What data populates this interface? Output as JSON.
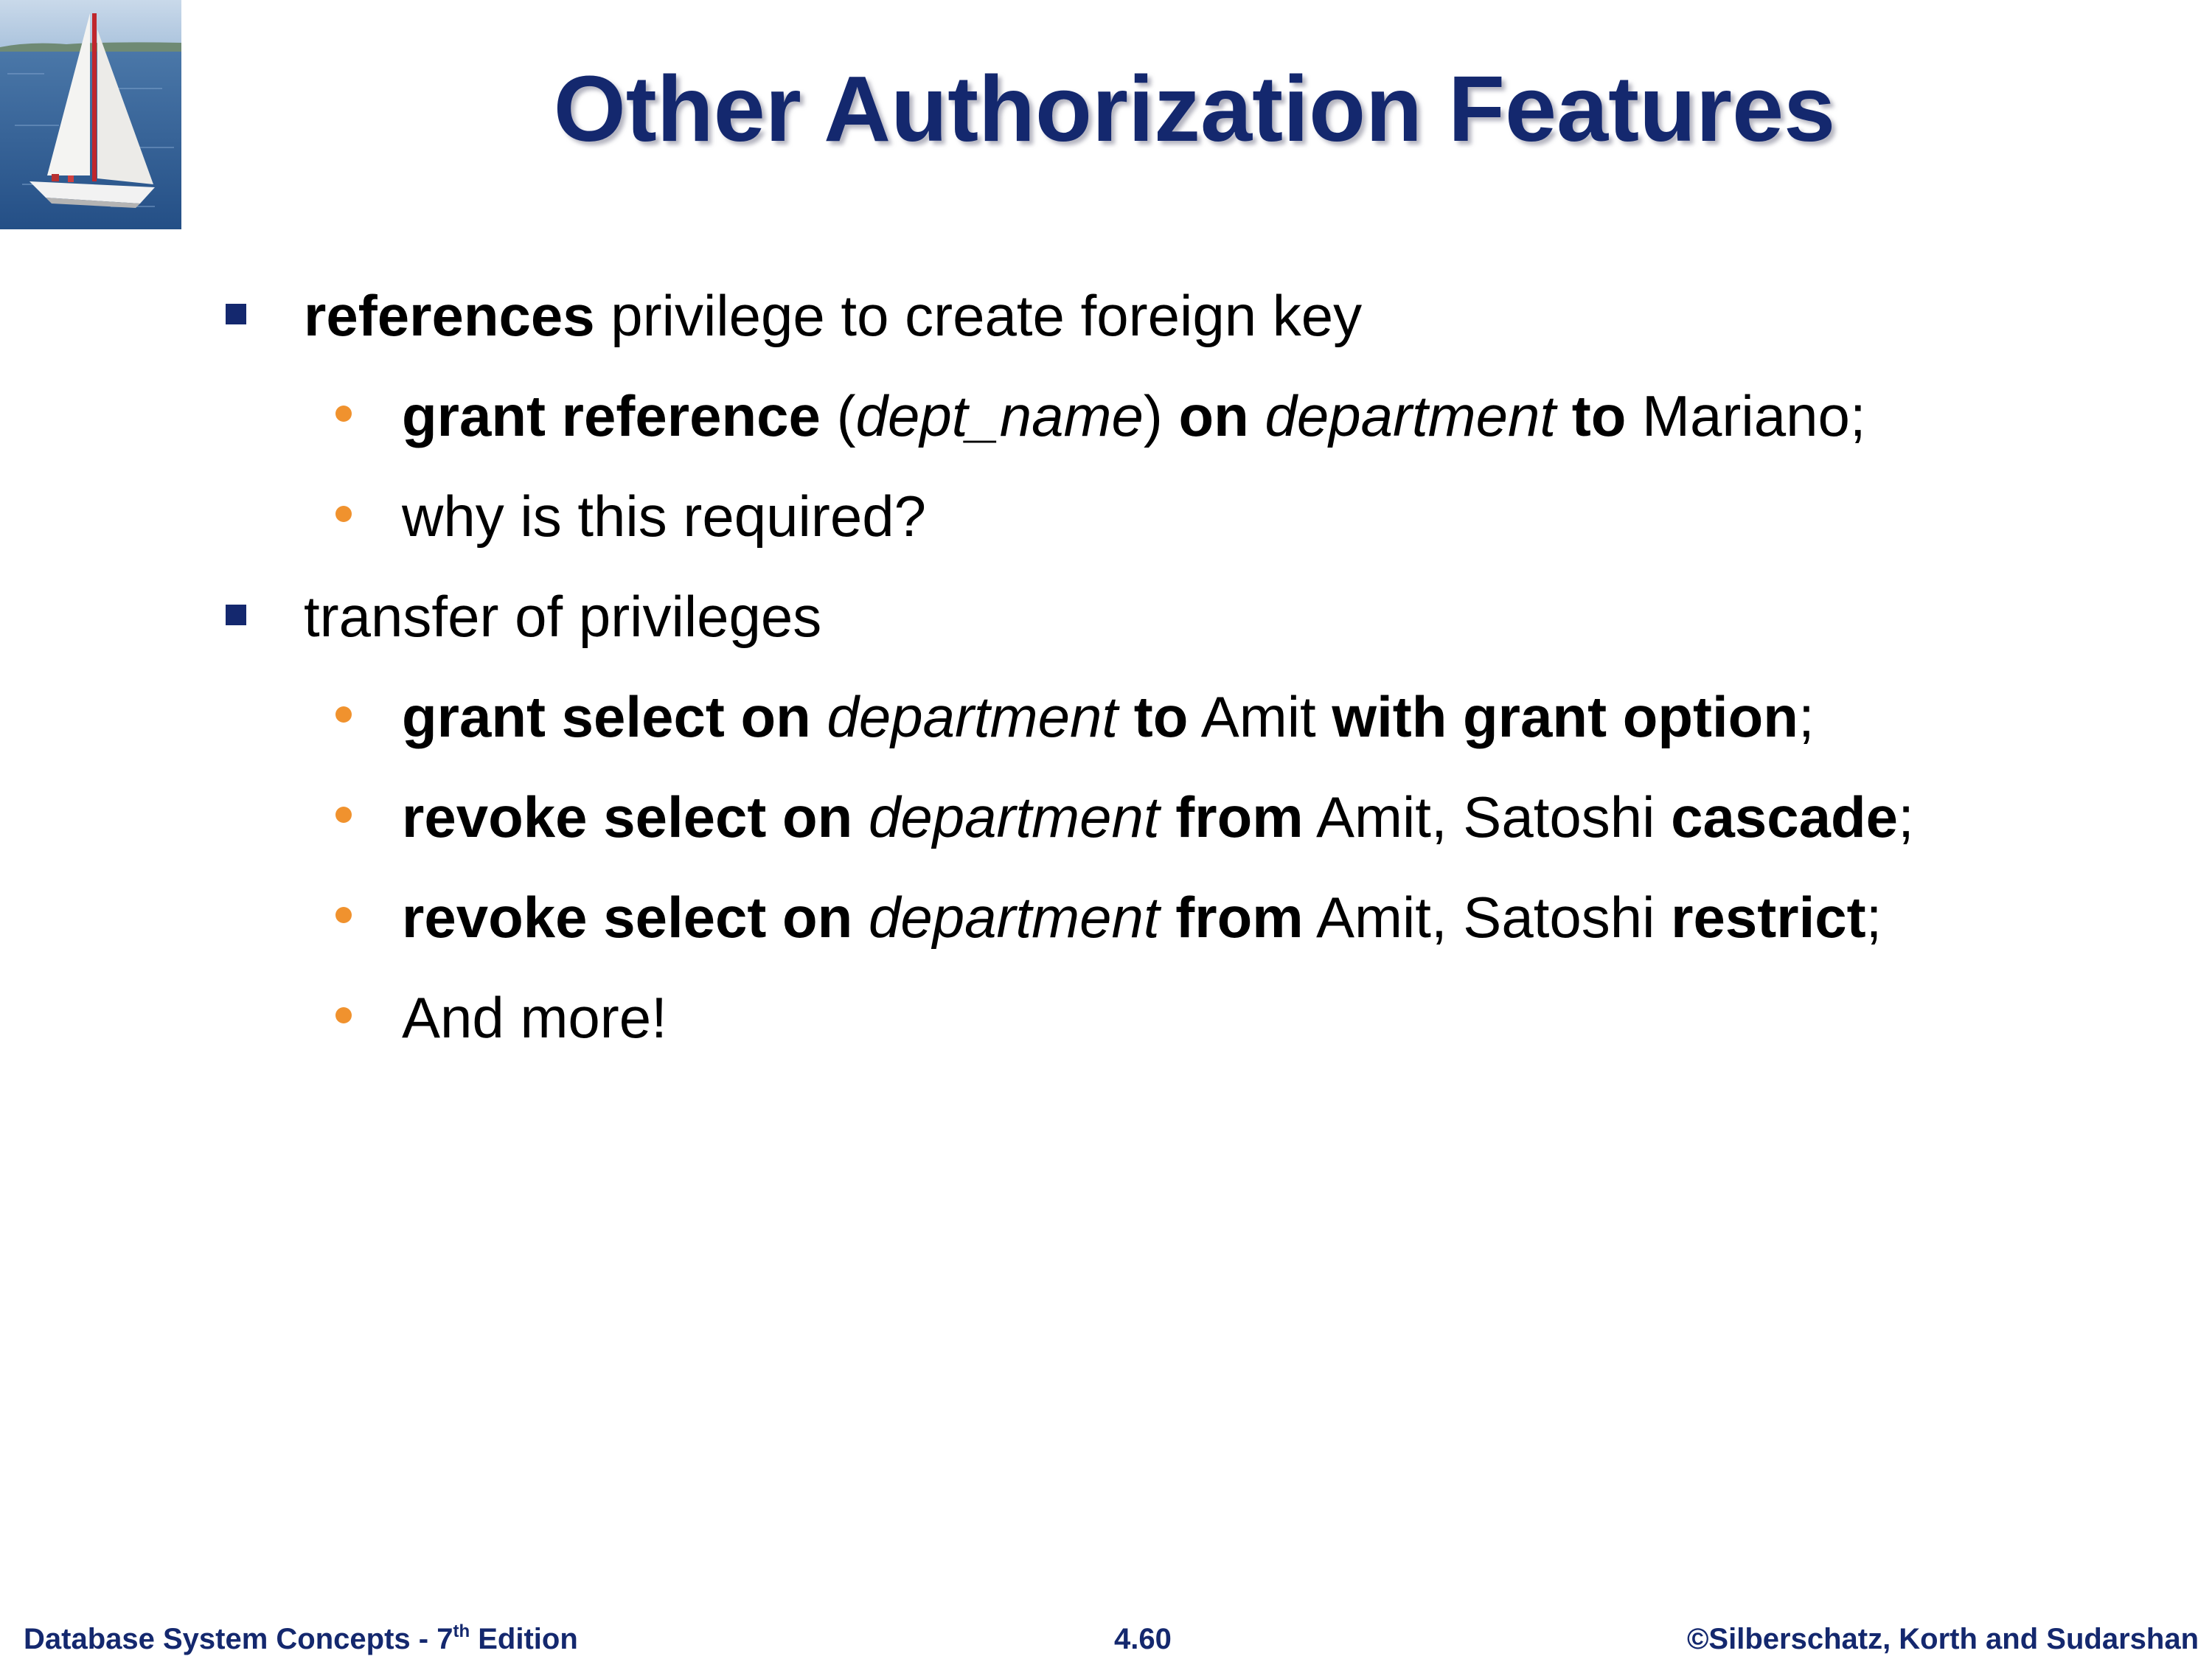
{
  "slide": {
    "title": "Other Authorization Features",
    "logo_icon": "sailboat-photo",
    "colors": {
      "title": "#14286e",
      "square_bullet": "#14286e",
      "dot_bullet": "#f0922e",
      "footer": "#14286e"
    }
  },
  "bullets": {
    "b1": {
      "bold": "references",
      "rest": " privilege to create foreign key"
    },
    "b1_1": {
      "p1": "grant reference",
      "p2": " (",
      "p3": "dept_name",
      "p4": ") ",
      "p5": "on",
      "p6": " ",
      "p7": "department",
      "p8": " ",
      "p9": "to",
      "p10": " Mariano;"
    },
    "b1_2": {
      "text": "why is this required?"
    },
    "b2": {
      "text": "transfer of privileges"
    },
    "b2_1": {
      "p1": "grant select on",
      "p2": " ",
      "p3": "department",
      "p4": " ",
      "p5": "to",
      "p6": " Amit ",
      "p7": "with grant option",
      "p8": ";"
    },
    "b2_2": {
      "p1": "revoke select on",
      "p2": " ",
      "p3": "department",
      "p4": " ",
      "p5": "from",
      "p6": " Amit, Satoshi ",
      "p7": "cascade",
      "p8": ";"
    },
    "b2_3": {
      "p1": "revoke select on",
      "p2": " ",
      "p3": "department",
      "p4": " ",
      "p5": "from",
      "p6": " Amit, Satoshi ",
      "p7": "restrict",
      "p8": ";"
    },
    "b2_4": {
      "text": "And more!"
    }
  },
  "footer": {
    "left_pre": "Database System Concepts - 7",
    "left_sup": "th",
    "left_post": " Edition",
    "center": "4.60",
    "right": "©Silberschatz, Korth and Sudarshan"
  }
}
